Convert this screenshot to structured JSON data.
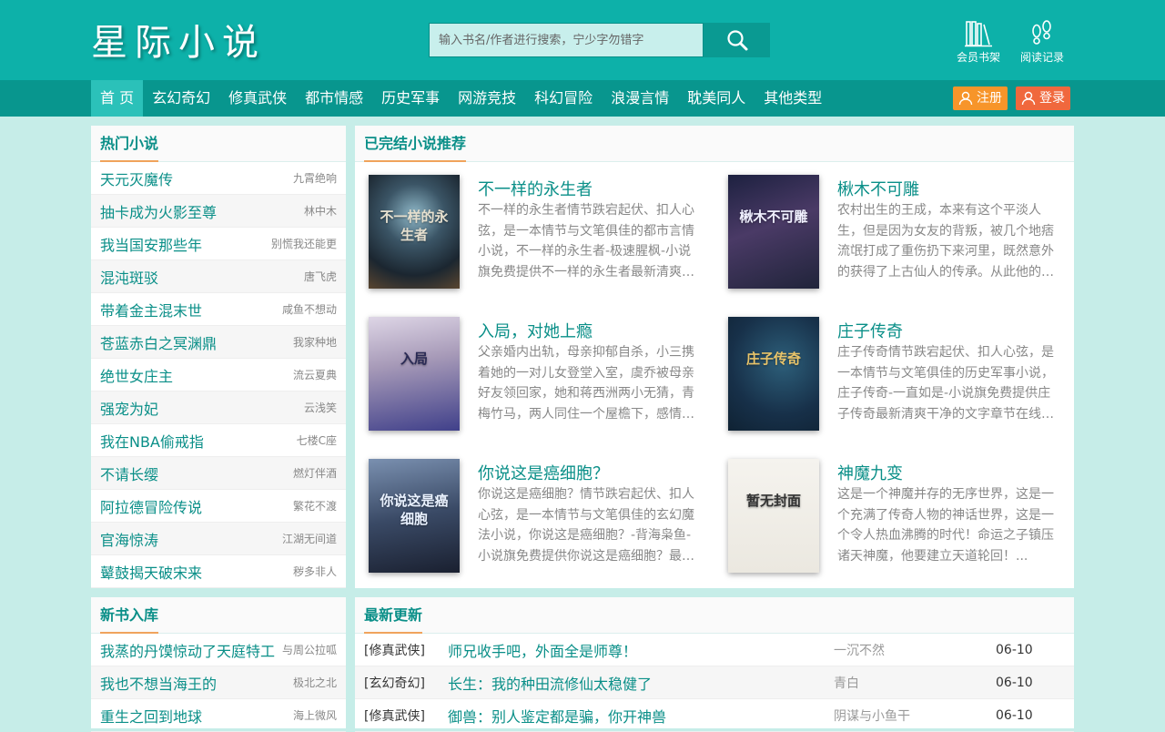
{
  "site": {
    "logo": "星际小说"
  },
  "search": {
    "placeholder": "输入书名/作者进行搜索，宁少字勿错字"
  },
  "header_links": [
    {
      "label": "会员书架"
    },
    {
      "label": "阅读记录"
    }
  ],
  "nav": [
    "首 页",
    "玄幻奇幻",
    "修真武侠",
    "都市情感",
    "历史军事",
    "网游竞技",
    "科幻冒险",
    "浪漫言情",
    "耽美同人",
    "其他类型"
  ],
  "auth": {
    "register": "注册",
    "login": "登录"
  },
  "hot": {
    "title": "热门小说",
    "items": [
      {
        "title": "天元灭魔传",
        "author": "九霄绝响"
      },
      {
        "title": "抽卡成为火影至尊",
        "author": "林中木"
      },
      {
        "title": "我当国安那些年",
        "author": "别慌我还能更"
      },
      {
        "title": "混沌斑驳",
        "author": "唐飞虎"
      },
      {
        "title": "带着金主混末世",
        "author": "咸鱼不想动"
      },
      {
        "title": "苍蓝赤白之冥渊鼎",
        "author": "我家种地"
      },
      {
        "title": "绝世女庄主",
        "author": "流云夏典"
      },
      {
        "title": "强宠为妃",
        "author": "云浅笑"
      },
      {
        "title": "我在NBA偷戒指",
        "author": "七楼C座"
      },
      {
        "title": "不请长缨",
        "author": "燃灯伴酒"
      },
      {
        "title": "阿拉德冒险传说",
        "author": "繁花不渡"
      },
      {
        "title": "官海惊涛",
        "author": "江湖无间道"
      },
      {
        "title": "鼙鼓揭天破宋来",
        "author": "秽多非人"
      }
    ]
  },
  "completed": {
    "title": "已完结小说推荐",
    "books": [
      {
        "name": "不一样的永生者",
        "desc": "不一样的永生者情节跌宕起伏、扣人心弦，是一本情节与文笔俱佳的都市言情小说，不一样的永生者-极速腥枫-小说旗免费提供不一样的永生者最新清爽干净的文字章节在线阅读。",
        "cover_text": "不一样的永生者"
      },
      {
        "name": "楸木不可雕",
        "desc": "农村出生的王成，本来有这个平淡人生，但是因为女友的背叛，被几个地痞流氓打成了重伤扔下来河里，既然意外的获得了上古仙人的传承。从此他的人生开始不一样了。",
        "cover_text": "楸木不可雕"
      },
      {
        "name": "入局，对她上瘾",
        "desc": "父亲婚内出轨，母亲抑郁自杀，小三携着她的一对儿女登堂入室，虞乔被母亲好友领回家，她和蒋西洲两小无猜，青梅竹马，两人同住一个屋檐下，感情日渐深厚。",
        "cover_text": "入局"
      },
      {
        "name": "庄子传奇",
        "desc": "庄子传奇情节跌宕起伏、扣人心弦，是一本情节与文笔俱佳的历史军事小说，庄子传奇-一直如是-小说旗免费提供庄子传奇最新清爽干净的文字章节在线阅读。",
        "cover_text": "庄子传奇"
      },
      {
        "name": "你说这是癌细胞？",
        "desc": "你说这是癌细胞？情节跌宕起伏、扣人心弦，是一本情节与文笔俱佳的玄幻魔法小说，你说这是癌细胞？-背海枭鱼-小说旗免费提供你说这是癌细胞？最新清爽干净的文字章节在线阅读。",
        "cover_text": "你说这是癌细胞"
      },
      {
        "name": "神魔九变",
        "desc": "这是一个神魔并存的无序世界，这是一个充满了传奇人物的神话世界，这是一个令人热血沸腾的时代！命运之子镇压诸天神魔，他要建立天道轮回！...",
        "cover_text": "暂无封面"
      }
    ]
  },
  "newbooks": {
    "title": "新书入库",
    "items": [
      {
        "title": "我蒸的丹馍惊动了天庭特工",
        "author": "与周公拉呱"
      },
      {
        "title": "我也不想当海王的",
        "author": "极北之北"
      },
      {
        "title": "重生之回到地球",
        "author": "海上微风"
      }
    ]
  },
  "latest": {
    "title": "最新更新",
    "items": [
      {
        "cat": "[修真武侠]",
        "title": "师兄收手吧，外面全是师尊！",
        "author": "一沉不然",
        "date": "06-10"
      },
      {
        "cat": "[玄幻奇幻]",
        "title": "长生：我的种田流修仙太稳健了",
        "author": "青白",
        "date": "06-10"
      },
      {
        "cat": "[修真武侠]",
        "title": "御兽：别人鉴定都是骗，你开神兽",
        "author": "阴谋与小鱼干",
        "date": "06-10"
      }
    ]
  },
  "colors": {
    "header": "#0db1a9",
    "nav": "#08968e",
    "accent": "#0a8f88",
    "register": "#f7952a",
    "login": "#f0683d"
  },
  "icons": {
    "search": "magnifier-icon",
    "bookshelf": "books-icon",
    "history": "footprints-icon",
    "user": "user-icon"
  }
}
